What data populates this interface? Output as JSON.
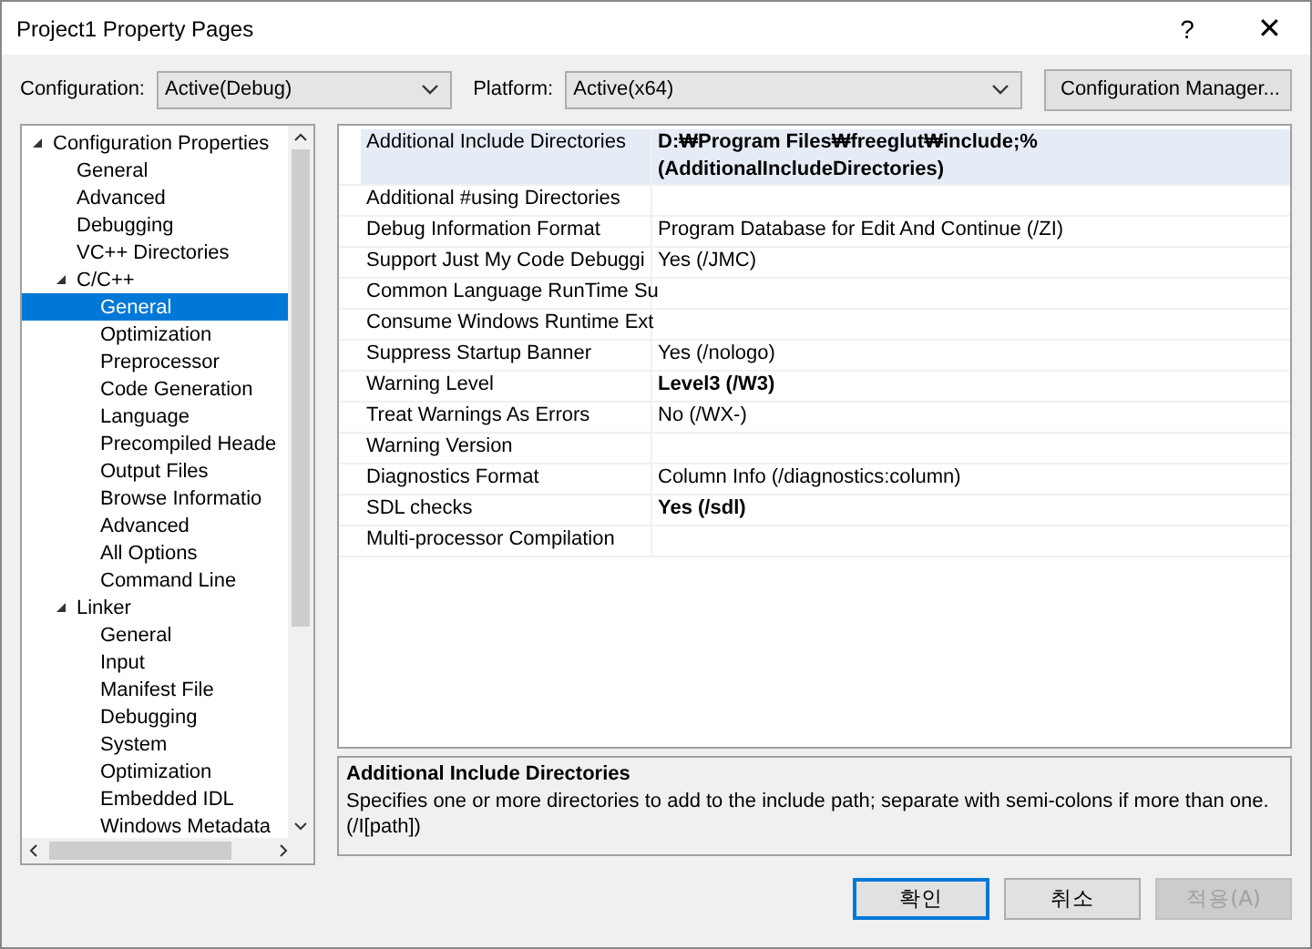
{
  "window": {
    "title": "Project1 Property Pages",
    "help": "?",
    "close": "✕"
  },
  "toolbar": {
    "configuration_label": "Configuration:",
    "configuration": "Active(Debug)",
    "platform_label": "Platform:",
    "platform": "Active(x64)",
    "manager_button": "Configuration Manager..."
  },
  "tree": [
    {
      "label": "Configuration Properties",
      "expanded": true,
      "selected": false,
      "children": [
        {
          "label": "General",
          "selected": false
        },
        {
          "label": "Advanced",
          "selected": false
        },
        {
          "label": "Debugging",
          "selected": false
        },
        {
          "label": "VC++ Directories",
          "selected": false
        },
        {
          "label": "C/C++",
          "expanded": true,
          "selected": false,
          "children": [
            {
              "label": "General",
              "selected": true
            },
            {
              "label": "Optimization",
              "selected": false
            },
            {
              "label": "Preprocessor",
              "selected": false
            },
            {
              "label": "Code Generation",
              "selected": false
            },
            {
              "label": "Language",
              "selected": false
            },
            {
              "label": "Precompiled Heade",
              "selected": false
            },
            {
              "label": "Output Files",
              "selected": false
            },
            {
              "label": "Browse Informatio",
              "selected": false
            },
            {
              "label": "Advanced",
              "selected": false
            },
            {
              "label": "All Options",
              "selected": false
            },
            {
              "label": "Command Line",
              "selected": false
            }
          ]
        },
        {
          "label": "Linker",
          "expanded": true,
          "selected": false,
          "children": [
            {
              "label": "General",
              "selected": false
            },
            {
              "label": "Input",
              "selected": false
            },
            {
              "label": "Manifest File",
              "selected": false
            },
            {
              "label": "Debugging",
              "selected": false
            },
            {
              "label": "System",
              "selected": false
            },
            {
              "label": "Optimization",
              "selected": false
            },
            {
              "label": "Embedded IDL",
              "selected": false
            },
            {
              "label": "Windows Metadata",
              "selected": false
            }
          ]
        }
      ]
    }
  ],
  "properties": [
    {
      "name": "Additional Include Directories",
      "value": "D:₩Program Files₩freeglut₩include;%(AdditionalIncludeDirectories)",
      "modified": true,
      "selected": true
    },
    {
      "name": "Additional #using Directories",
      "selected": false
    },
    {
      "name": "Debug Information Format",
      "value": "Program Database for Edit And Continue (/ZI)",
      "modified": false,
      "selected": false
    },
    {
      "name": "Support Just My Code Debuggi",
      "value": "Yes (/JMC)",
      "modified": false,
      "selected": false
    },
    {
      "name": "Common Language RunTime Su",
      "selected": false
    },
    {
      "name": "Consume Windows Runtime Ext",
      "selected": false
    },
    {
      "name": "Suppress Startup Banner",
      "value": "Yes (/nologo)",
      "modified": false,
      "selected": false
    },
    {
      "name": "Warning Level",
      "value": "Level3 (/W3)",
      "modified": true,
      "selected": false
    },
    {
      "name": "Treat Warnings As Errors",
      "value": "No (/WX-)",
      "modified": false,
      "selected": false
    },
    {
      "name": "Warning Version",
      "selected": false
    },
    {
      "name": "Diagnostics Format",
      "value": "Column Info (/diagnostics:column)",
      "modified": false,
      "selected": false
    },
    {
      "name": "SDL checks",
      "value": "Yes (/sdl)",
      "modified": true,
      "selected": false
    },
    {
      "name": "Multi-processor Compilation",
      "selected": false
    }
  ],
  "description": {
    "title": "Additional Include Directories",
    "text": "Specifies one or more directories to add to the include path; separate with semi-colons if more than one. (/I[path])"
  },
  "buttons": [
    {
      "label": "확인",
      "disabled": false,
      "default": true
    },
    {
      "label": "취소",
      "disabled": false,
      "default": false
    },
    {
      "label": "적용(A)",
      "disabled": true,
      "default": false
    }
  ]
}
